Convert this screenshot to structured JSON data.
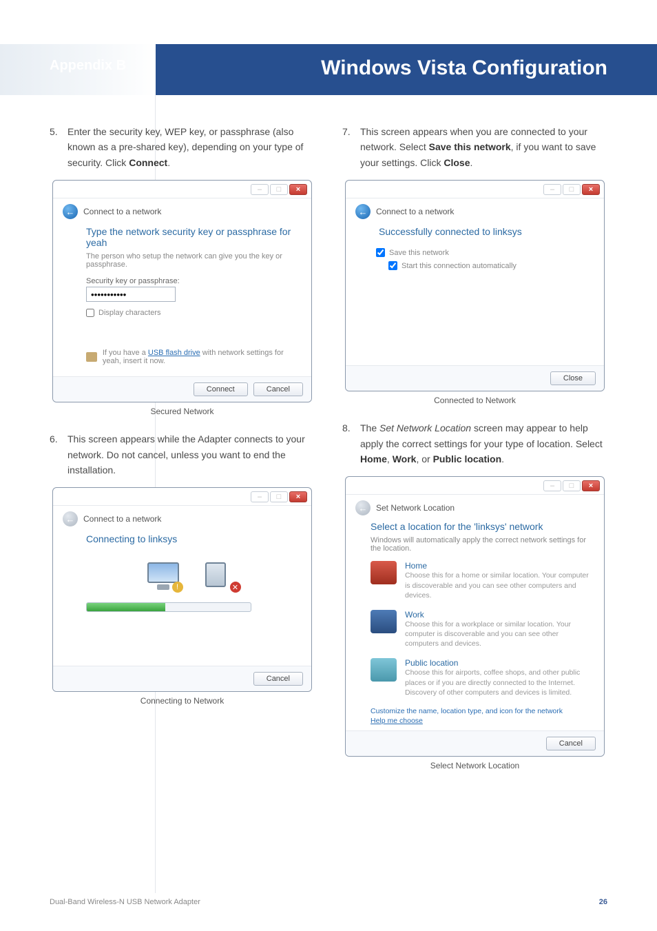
{
  "header": {
    "appendix": "Appendix B",
    "title": "Windows Vista Configuration"
  },
  "steps": {
    "s5_num": "5.",
    "s5_body_a": "Enter the security key, WEP key, or passphrase (also known as a pre-shared key), depending on your type of security. Click ",
    "s5_body_b": "Connect",
    "s5_body_c": ".",
    "s6_num": "6.",
    "s6_body": "This screen appears while the Adapter connects to your network. Do not cancel, unless you want to end the installation.",
    "s7_num": "7.",
    "s7_body_a": "This screen appears when you are connected to your network. Select ",
    "s7_body_b": "Save this network",
    "s7_body_c": ", if you want to save your settings. Click ",
    "s7_body_d": "Close",
    "s7_body_e": ".",
    "s8_num": "8.",
    "s8_body_a": "The ",
    "s8_body_b": "Set Network Location",
    "s8_body_c": " screen may appear to help apply the correct settings for your type of location. Select ",
    "s8_body_d": "Home",
    "s8_body_e": ", ",
    "s8_body_f": "Work",
    "s8_body_g": ", or ",
    "s8_body_h": "Public location",
    "s8_body_i": "."
  },
  "captions": {
    "secured": "Secured Network",
    "connecting": "Connecting to Network",
    "connected": "Connected to Network",
    "location": "Select Network Location"
  },
  "dialog_common": {
    "crumb": "Connect to a network",
    "close_glyph": "×",
    "min_glyph": "–",
    "max_glyph": "□"
  },
  "dlg_secured": {
    "heading": "Type the network security key or passphrase for yeah",
    "sub": "The person who setup the network can give you the key or passphrase.",
    "field_label": "Security key or passphrase:",
    "field_value": "•••••••••••",
    "chk_label": "Display characters",
    "tip_pre": "If you have a ",
    "tip_link": "USB flash drive",
    "tip_post": " with network settings for yeah, insert it now.",
    "btn_connect": "Connect",
    "btn_cancel": "Cancel"
  },
  "dlg_connecting": {
    "heading": "Connecting to linksys",
    "btn_cancel": "Cancel"
  },
  "dlg_connected": {
    "heading": "Successfully connected to linksys",
    "opt_save": "Save this network",
    "opt_auto": "Start this connection automatically",
    "btn_close": "Close"
  },
  "dlg_location": {
    "crumb": "Set Network Location",
    "heading": "Select a location for the 'linksys' network",
    "sub": "Windows will automatically apply the correct network settings for the location.",
    "home_title": "Home",
    "home_desc": "Choose this for a home or similar location. Your computer is discoverable and you can see other computers and devices.",
    "work_title": "Work",
    "work_desc": "Choose this for a workplace or similar location. Your computer is discoverable and you can see other computers and devices.",
    "public_title": "Public location",
    "public_desc": "Choose this for airports, coffee shops, and other public places or if you are directly connected to the Internet. Discovery of other computers and devices is limited.",
    "customize": "Customize the name, location type, and icon for the network",
    "help": "Help me choose",
    "btn_cancel": "Cancel"
  },
  "footer": {
    "product": "Dual-Band Wireless-N USB Network Adapter",
    "page": "26"
  }
}
